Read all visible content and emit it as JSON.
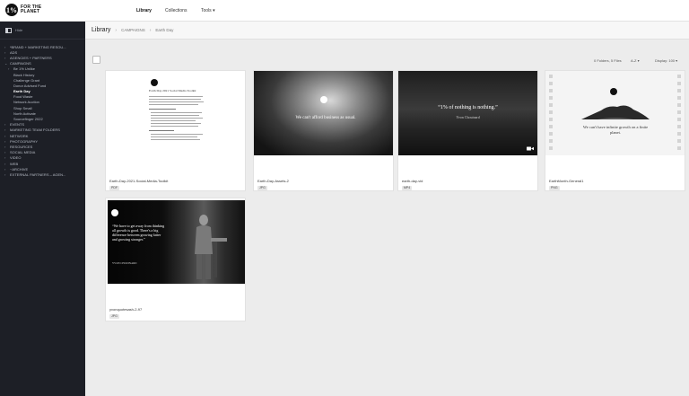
{
  "topbar": {
    "logo_mark": "1%",
    "logo_text": "FOR THE PLANET",
    "nav": [
      {
        "label": "Library",
        "active": true
      },
      {
        "label": "Collections",
        "active": false
      },
      {
        "label": "Tools",
        "active": false
      }
    ]
  },
  "sidebar": {
    "head_label": "Hide",
    "items": [
      {
        "label": "*BRAND + MARKETING RESOU...",
        "level": 0,
        "expanded": false
      },
      {
        "label": "ADS",
        "level": 0,
        "expanded": false
      },
      {
        "label": "AGENCIES + PARTNERS",
        "level": 0,
        "expanded": false
      },
      {
        "label": "CAMPAIGNS",
        "level": 0,
        "expanded": true
      },
      {
        "label": "Be 1% Unlike",
        "level": 1,
        "expanded": false
      },
      {
        "label": "Black History",
        "level": 1
      },
      {
        "label": "Challenge Grant",
        "level": 1
      },
      {
        "label": "Donor Advised Fund",
        "level": 1
      },
      {
        "label": "Earth Day",
        "level": 1,
        "active": true
      },
      {
        "label": "Food Waste",
        "level": 1
      },
      {
        "label": "Network Auction",
        "level": 1
      },
      {
        "label": "Shop Small",
        "level": 1
      },
      {
        "label": "North Activate",
        "level": 1
      },
      {
        "label": "Sourcefinger 2022",
        "level": 1
      },
      {
        "label": "EVENTS",
        "level": 0
      },
      {
        "label": "MARKETING TEAM FOLDERS",
        "level": 0
      },
      {
        "label": "NETWORK",
        "level": 0
      },
      {
        "label": "PHOTOGRAPHY",
        "level": 0
      },
      {
        "label": "RESOURCES",
        "level": 0
      },
      {
        "label": "SOCIAL MEDIA",
        "level": 0
      },
      {
        "label": "VIDEO",
        "level": 0
      },
      {
        "label": "WEB",
        "level": 0
      },
      {
        "label": "~ARCHIVE",
        "level": 0
      },
      {
        "label": "EXTERNAL PARTNERS – AGEN...",
        "level": 0
      }
    ]
  },
  "header": {
    "title": "Library",
    "breadcrumb": [
      "CAMPAIGNS",
      "Earth Day"
    ]
  },
  "toolbar": {
    "count": "0 Folders, 5 Files",
    "sort": "A-Z",
    "display": "Display: 100"
  },
  "cards": [
    {
      "title": "Earth-Day-2021-Social-Media-Toolkit",
      "badge": "PDF",
      "kind": "document",
      "doc_heading": "Earth Day 2021 Social Media Toolkit"
    },
    {
      "title": "Earth-Day-Assets-2",
      "badge": "JPG",
      "kind": "clouds",
      "quote": "We can't afford business as usual."
    },
    {
      "title": "earth-day-vid",
      "badge": "MP4",
      "kind": "sea",
      "quote": "“1% of nothing is nothing.”",
      "attribution": "Yvon Chouinard"
    },
    {
      "title": "EarthMonth-General1",
      "badge": "PNG",
      "kind": "island",
      "quote": "We can't have infinite growth on a finite planet."
    },
    {
      "title": "yvonquotesash-2-97",
      "badge": "JPG",
      "kind": "workshop",
      "quote": "“We have to get away from thinking all growth is good. There's a big difference between growing fatter and growing stronger.”",
      "attribution": "YVON CHOUINARD"
    }
  ],
  "icons": [
    "folder-chevron-icon",
    "sidebar-toggle-icon",
    "video-icon",
    "chevron-down-icon"
  ],
  "colors": {
    "sidebar_bg": "#1d1f26",
    "main_bg": "#ececec",
    "card_bg": "#ffffff"
  }
}
